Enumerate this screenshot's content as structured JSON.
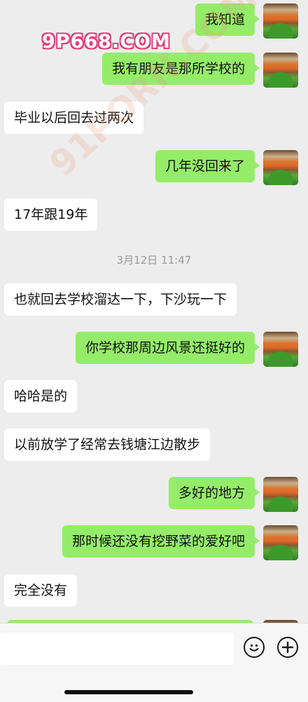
{
  "watermarks": {
    "top": "9P668.COM",
    "diagonal": "91PORN.COM"
  },
  "messages": [
    {
      "side": "out",
      "text": "我知道"
    },
    {
      "side": "out",
      "text": "我有朋友是那所学校的"
    },
    {
      "side": "in",
      "text": "毕业以后回去过两次"
    },
    {
      "side": "out",
      "text": "几年没回来了"
    },
    {
      "side": "in",
      "text": "17年跟19年"
    },
    {
      "side": "in",
      "text": "也就回去学校溜达一下，下沙玩一下"
    },
    {
      "side": "out",
      "text": "你学校那周边风景还挺好的"
    },
    {
      "side": "in",
      "text": "哈哈是的"
    },
    {
      "side": "in",
      "text": "以前放学了经常去钱塘江边散步"
    },
    {
      "side": "out",
      "text": "多好的地方"
    },
    {
      "side": "out",
      "text": "那时候还没有挖野菜的爱好吧"
    },
    {
      "side": "in",
      "text": "完全没有"
    }
  ],
  "timestamp": "3月12日 11:47",
  "input_bar": {
    "emoji_icon": "emoji-icon",
    "add_icon": "plus-circle-icon"
  },
  "colors": {
    "outgoing_bubble": "#95ec69",
    "incoming_bubble": "#ffffff",
    "background": "#ededed"
  }
}
